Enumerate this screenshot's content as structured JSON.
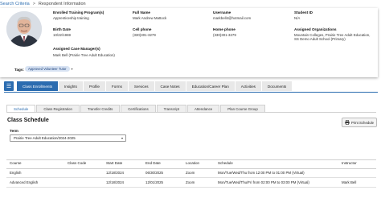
{
  "breadcrumb": {
    "link": "Search Criteria",
    "separator": ">",
    "current": "Respondent Information"
  },
  "profile": {
    "fields": [
      {
        "label": "Enrolled Training Program(s)",
        "value": "Apprenticeship training"
      },
      {
        "label": "Full Name",
        "value": "Mark Andrew Mattock"
      },
      {
        "label": "Username",
        "value": "markbell4@hotmail.com"
      },
      {
        "label": "Student ID",
        "value": "N/A"
      },
      {
        "label": "Birth Date",
        "value": "10/22/1969"
      },
      {
        "label": "Cell phone",
        "value": "(330)301-3279"
      },
      {
        "label": "Home phone",
        "value": "(330)301-3279"
      },
      {
        "label": "Assigned Organizations",
        "value": "Mountain Colleges, Prairie Tree Adult Education, SS Demo Adult School (Primary)"
      },
      {
        "label": "Assigned Case Manager(s)",
        "value": "Mark Bell (Prairie Tree Adult Education)"
      }
    ],
    "tags_label": "Tags:",
    "tag": "Approved Volunteer Tutor"
  },
  "main_tabs": [
    "Class Enrollments",
    "Insights",
    "Profile",
    "Forms",
    "Services",
    "Case Notes",
    "Education/Career Plan",
    "Activities",
    "Documents"
  ],
  "sub_tabs": [
    "Schedule",
    "Class Registration",
    "Transfer Credits",
    "Certifications",
    "Transcript",
    "Attendance",
    "Plan Course Group"
  ],
  "schedule": {
    "title": "Class Schedule",
    "print_label": "Print Schedule",
    "term_label": "Term",
    "term_value": "Prairie Tree Adult Education/2024-2025",
    "columns": [
      "Course",
      "Class Code",
      "Start Date",
      "End Date",
      "Location",
      "Schedule",
      "Instructor"
    ],
    "rows": [
      [
        "English",
        "",
        "12/18/2024",
        "06/30/2025",
        "Zoom",
        "Mon/Tue/Wed/Thu from 12:00 PM to 01:00 PM (Virtual)",
        ""
      ],
      [
        "Advanced English",
        "",
        "12/18/2024",
        "12/01/2025",
        "Zoom",
        "Mon/Tue/Wed/Thu/Fri from 02:00 PM to 03:00 PM (Virtual)",
        "Mark Bell"
      ]
    ]
  },
  "colors": {
    "accent": "#2b6cb0",
    "tag_bg": "#d8e3f3"
  },
  "icons": {
    "menu": "hamburger-icon",
    "print": "printer-icon",
    "select": "chevron-down-icon"
  }
}
